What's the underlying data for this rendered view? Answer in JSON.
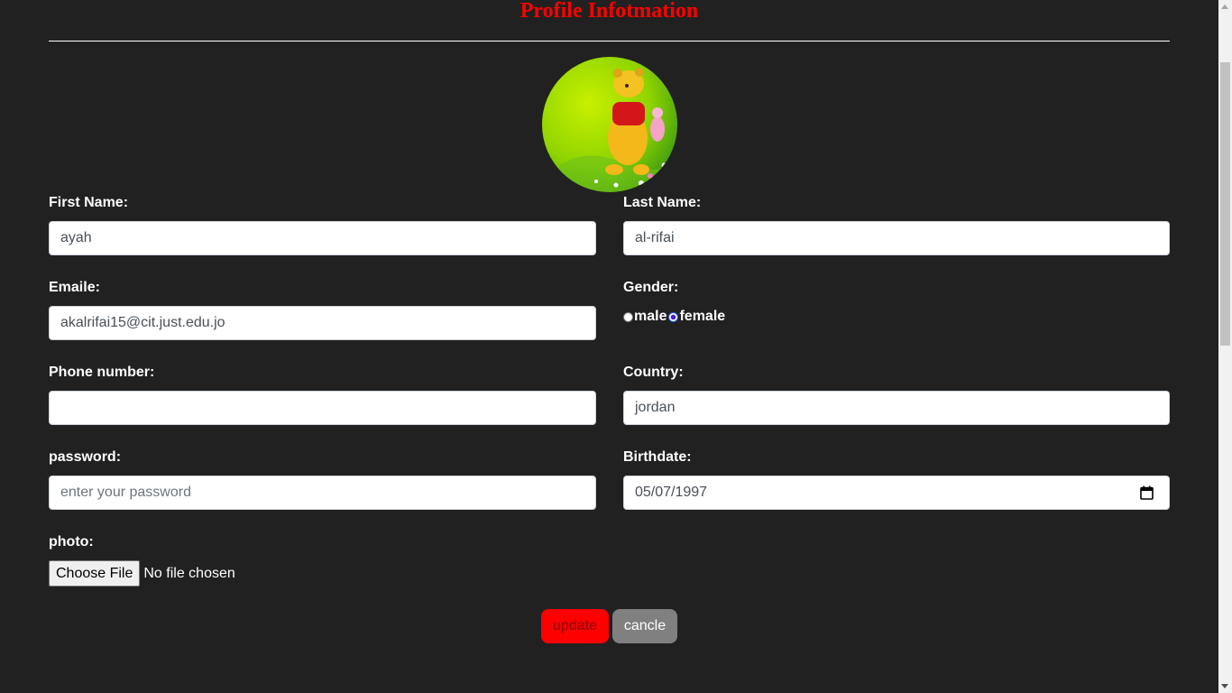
{
  "page": {
    "title": "Profile Infotmation"
  },
  "avatar": {
    "icon": "winnie-the-pooh-profile-photo"
  },
  "form": {
    "first_name": {
      "label": "First Name:",
      "value": "ayah"
    },
    "last_name": {
      "label": "Last Name:",
      "value": "al-rifai"
    },
    "email": {
      "label": "Emaile:",
      "value": "akalrifai15@cit.just.edu.jo"
    },
    "gender": {
      "label": "Gender:",
      "options": [
        {
          "label": "male",
          "checked": false
        },
        {
          "label": "female",
          "checked": true
        }
      ]
    },
    "phone": {
      "label": "Phone number:",
      "value": ""
    },
    "country": {
      "label": "Country:",
      "value": "jordan"
    },
    "password": {
      "label": "password:",
      "value": "",
      "placeholder": "enter your password"
    },
    "birthdate": {
      "label": "Birthdate:",
      "value": "05/07/1997",
      "icon": "calendar-icon"
    },
    "photo": {
      "label": "photo:",
      "button_label": "Choose File",
      "status": "No file chosen"
    }
  },
  "actions": {
    "update_label": "update",
    "cancel_label": "cancle"
  },
  "colors": {
    "background": "#212121",
    "title": "#ff0000",
    "update_button": "#ff0000",
    "cancel_button": "#808080"
  }
}
